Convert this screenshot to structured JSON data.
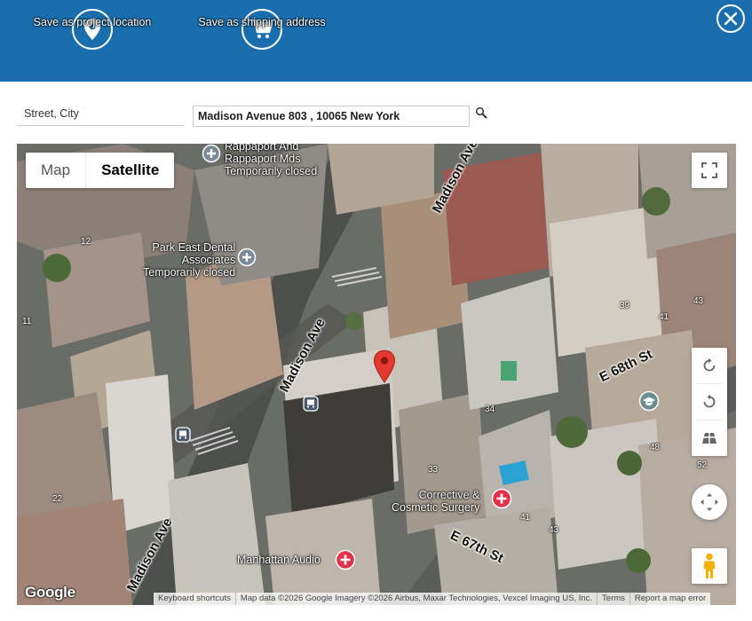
{
  "header": {
    "project_location_label": "Save as project location",
    "shipping_address_label": "Save as shipping address"
  },
  "search": {
    "field_label": "Street, City",
    "address_value": "Madison Avenue 803 , 10065 New York"
  },
  "map": {
    "type_map_label": "Map",
    "type_satellite_label": "Satellite",
    "places": [
      {
        "name_lines": [
          "Rappaport And",
          "Rappaport Mds"
        ],
        "status": "Temporarily closed"
      },
      {
        "name_lines": [
          "Park East Dental",
          "Associates"
        ],
        "status": "Temporarily closed"
      },
      {
        "name_lines": [
          "Corrective &",
          "Cosmetic Surgery"
        ],
        "status": ""
      },
      {
        "name_lines": [
          "Manhattan Audio"
        ],
        "status": ""
      }
    ],
    "streets": [
      "Madison Ave",
      "Madison Ave",
      "Madison Ave",
      "E 68th St",
      "E 67th St"
    ],
    "building_numbers": [
      "12",
      "11",
      "39",
      "41",
      "43",
      "33",
      "34",
      "22",
      "48",
      "52",
      "41",
      "43"
    ],
    "attribution": {
      "logo": "Google",
      "shortcuts": "Keyboard shortcuts",
      "data": "Map data ©2026 Google Imagery ©2026 Airbus, Maxar Technologies, Vexcel Imaging US, Inc.",
      "terms": "Terms",
      "report": "Report a map error"
    }
  },
  "icons": {
    "location": "location-pin-icon",
    "cart": "shopping-cart-icon",
    "close": "close-icon",
    "search": "magnifier-icon",
    "fullscreen": "fullscreen-icon",
    "rotate_cw": "rotate-clockwise-icon",
    "rotate_ccw": "rotate-counterclockwise-icon",
    "tilt": "tilt-icon",
    "pan": "pan-arrows-icon",
    "pegman": "street-view-pegman-icon",
    "marker": "map-marker-icon"
  },
  "colors": {
    "header_bg": "#1b6eae",
    "marker": "#e23a2e",
    "poi_medical": "#e0334a",
    "poi_grey": "#7b8a96"
  }
}
